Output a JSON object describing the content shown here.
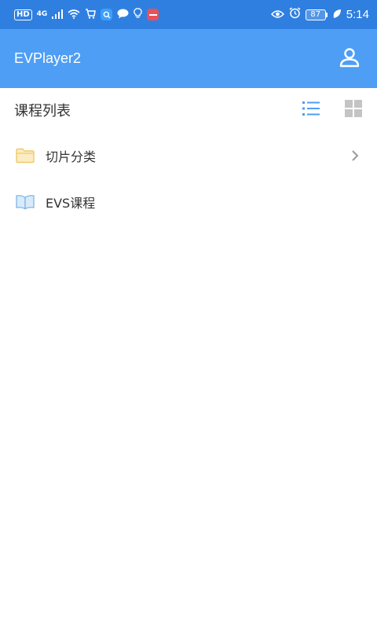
{
  "status_bar": {
    "hd_badge": "HD",
    "network": "4G",
    "battery_level": "87",
    "time": "5:14",
    "colors": {
      "background": "#2f7fe0"
    }
  },
  "app_bar": {
    "title": "EVPlayer2",
    "user_icon": "user-icon",
    "colors": {
      "background": "#4e9ef5"
    }
  },
  "section": {
    "title": "课程列表",
    "list_view_icon": "list-view-icon",
    "grid_view_icon": "grid-view-icon",
    "active_view": "list"
  },
  "items": [
    {
      "label": "切片分类",
      "icon": "folder-icon",
      "has_chevron": true
    },
    {
      "label": "EVS课程",
      "icon": "book-icon",
      "has_chevron": false
    }
  ]
}
